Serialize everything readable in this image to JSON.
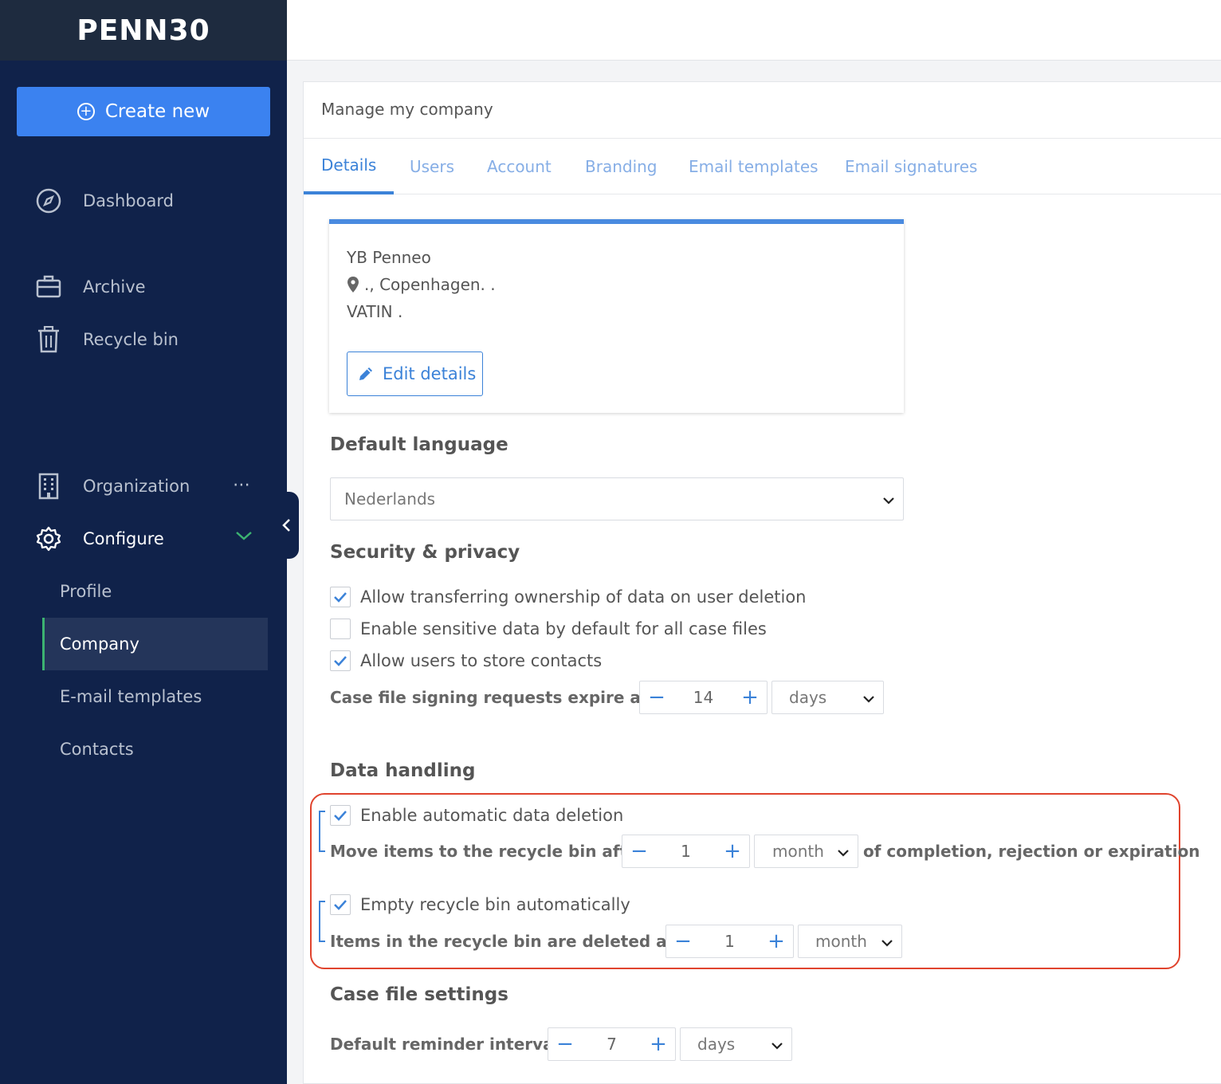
{
  "brand": {
    "logo_text": "PENN30",
    "accent": "#3b82f0",
    "sidebar_bg": "#10224a"
  },
  "sidebar": {
    "create_new": "Create new",
    "items": [
      {
        "label": "Dashboard",
        "icon": "compass-icon"
      },
      {
        "label": "Archive",
        "icon": "briefcase-icon"
      },
      {
        "label": "Recycle bin",
        "icon": "trash-icon"
      },
      {
        "label": "Organization",
        "icon": "building-icon"
      },
      {
        "label": "Configure",
        "icon": "gear-icon"
      }
    ],
    "org_more": "⋯",
    "sub_items": [
      {
        "label": "Profile"
      },
      {
        "label": "Company"
      },
      {
        "label": "E-mail templates"
      },
      {
        "label": "Contacts"
      }
    ]
  },
  "page": {
    "title": "Manage my company",
    "tabs": [
      {
        "label": "Details"
      },
      {
        "label": "Users"
      },
      {
        "label": "Account"
      },
      {
        "label": "Branding"
      },
      {
        "label": "Email templates"
      },
      {
        "label": "Email signatures"
      }
    ]
  },
  "company": {
    "name": "YB Penneo",
    "address": "., Copenhagen. .",
    "vatin": "VATIN .",
    "edit_label": "Edit details"
  },
  "language": {
    "heading": "Default language",
    "value": "Nederlands"
  },
  "security": {
    "heading": "Security & privacy",
    "options": [
      {
        "label": "Allow transferring ownership of data on user deletion",
        "checked": true
      },
      {
        "label": "Enable sensitive data by default for all case files",
        "checked": false
      },
      {
        "label": "Allow users to store contacts",
        "checked": true
      }
    ],
    "expire_label": "Case file signing requests expire after",
    "expire_value": "14",
    "expire_unit": "days"
  },
  "data_handling": {
    "heading": "Data handling",
    "auto_delete": {
      "label": "Enable automatic data deletion",
      "checked": true
    },
    "move_label": "Move items to the recycle bin after",
    "move_value": "1",
    "move_unit": "month",
    "move_suffix": "of completion, rejection or expiration",
    "empty_bin": {
      "label": "Empty recycle bin automatically",
      "checked": true
    },
    "delete_label": "Items in the recycle bin are deleted after",
    "delete_value": "1",
    "delete_unit": "month"
  },
  "case_file": {
    "heading": "Case file settings",
    "reminder_label": "Default reminder interval:",
    "reminder_value": "7",
    "reminder_unit": "days"
  },
  "stepper": {
    "minus": "−",
    "plus": "+"
  }
}
